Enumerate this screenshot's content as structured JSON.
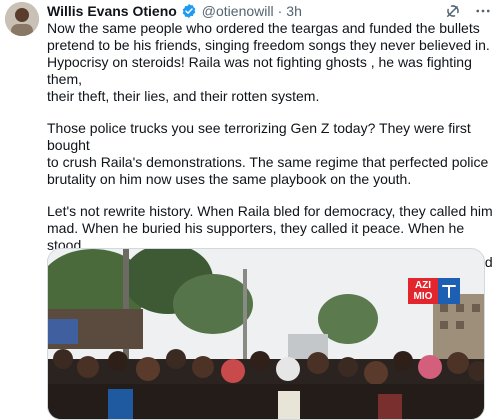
{
  "tweet": {
    "author": {
      "name": "Willis Evans Otieno",
      "handle": "@otienowill",
      "separator": "·",
      "time": "3h",
      "verified": true
    },
    "icons": {
      "verified": "verified-badge-icon",
      "grok": "grok-icon",
      "more": "more-options-icon"
    },
    "paragraphs": [
      "Now the same people who ordered the teargas and funded the bullets\npretend to be his friends, singing freedom songs they never believed in.\nHypocrisy on steroids! Raila was not fighting ghosts , he was fighting them,\ntheir theft, their lies, and their rotten system.",
      "Those police trucks you see terrorizing Gen Z today? They were first bought\nto crush Raila's demonstrations. The same regime that perfected police\nbrutality on him now uses the same playbook on the youth.",
      "Let's not rewrite history. When Raila bled for democracy, they called him\nmad. When he buried his supporters, they called it peace. When he stood\nfirm, they called it chaos. They broke his bones, then stole his voice  and\nnow want to borrow his legacy."
    ],
    "media": {
      "watermark": [
        "AZI",
        "MIO"
      ],
      "colors": {
        "sky": "#eef0f1",
        "trees": "#3e5a35",
        "crowd": "#2b2320"
      }
    }
  }
}
